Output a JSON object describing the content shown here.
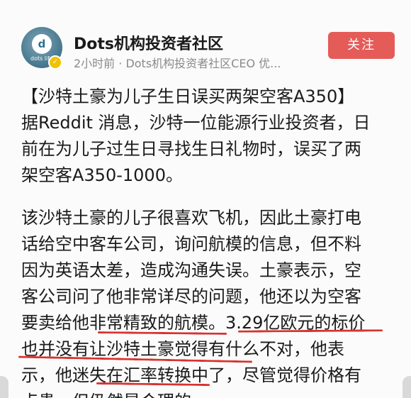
{
  "author": {
    "name": "Dots机构投资者社区",
    "avatar_text": "dots life",
    "avatar_letter": "d",
    "verified_icon": "✓",
    "meta": "2小时前 · Dots机构投资者社区CEO 优..."
  },
  "follow_button": {
    "label": "关注",
    "color": "#e45b58"
  },
  "post": {
    "lines": [
      "【沙特土豪为儿子生日误买两架空客A350】",
      "据Reddit 消息，沙特一位能源行业投资者，日",
      "前在为儿子过生日寻找生日礼物时，误买了两",
      "架空客A350-1000。",
      "该沙特土豪的儿子很喜欢飞机，因此土豪打电",
      "话给空中客车公司，询问航模的信息，但不料",
      "因为英语太差，造成沟通失误。土豪表示，空",
      "客公司问了他非常详尽的问题，他还以为空客",
      "要卖给他非常精致的航模。3.29亿欧元的标价",
      "也并没有让沙特土豪觉得有什么不对，他表",
      "示，他迷失在汇率转换中了，尽管觉得价格有",
      "点贵，但仍然是合理的。"
    ]
  },
  "annotation_color": "#d8322f"
}
